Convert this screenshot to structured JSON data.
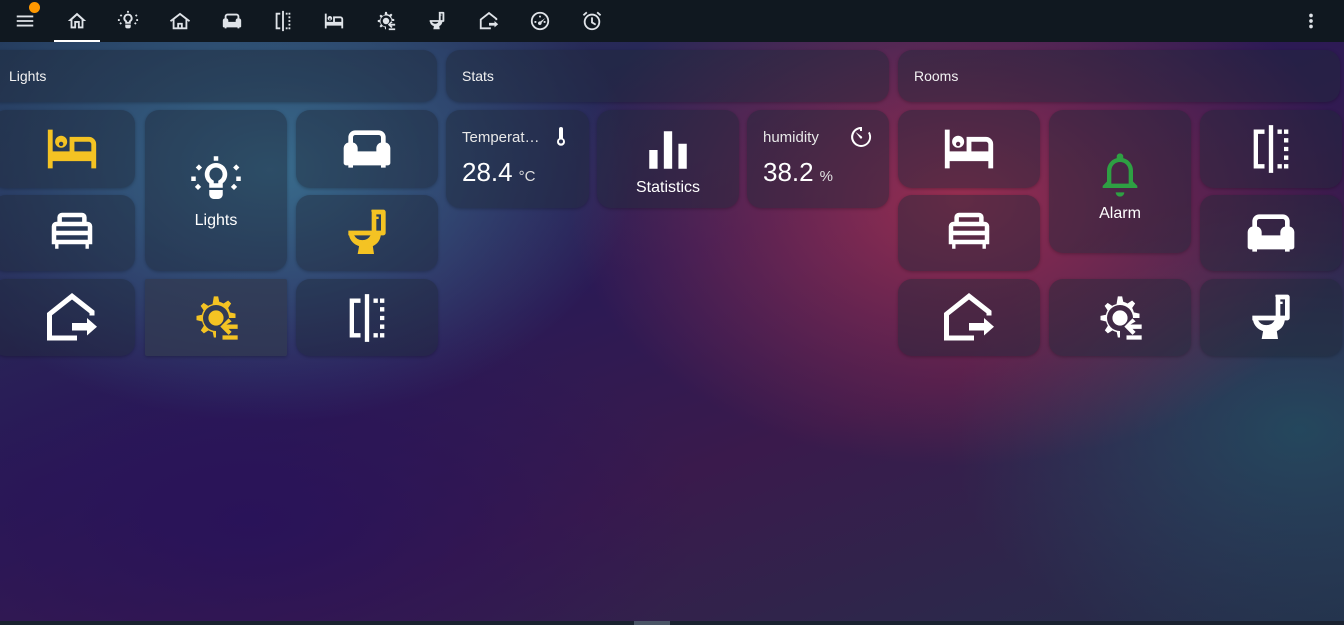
{
  "topbar": {
    "tabs": [
      {
        "icon": "menu-icon"
      },
      {
        "icon": "home-icon",
        "active": true
      },
      {
        "icon": "lightbulb-group-icon"
      },
      {
        "icon": "home-roof-icon"
      },
      {
        "icon": "sofa-icon"
      },
      {
        "icon": "door-divider-icon"
      },
      {
        "icon": "bed-icon"
      },
      {
        "icon": "cog-sync-icon"
      },
      {
        "icon": "toilet-icon"
      },
      {
        "icon": "home-export-icon"
      },
      {
        "icon": "gauge-icon"
      },
      {
        "icon": "alarm-clock-icon"
      }
    ],
    "more_icon": "dots-vertical-icon",
    "notification_color": "#ff9800"
  },
  "sections": {
    "lights": {
      "title": "Lights"
    },
    "stats": {
      "title": "Stats"
    },
    "rooms": {
      "title": "Rooms"
    }
  },
  "lights_tiles": {
    "group": {
      "name": "Lights",
      "icon": "lightbulb-group-icon"
    },
    "bedroom": {
      "icon": "bed-icon",
      "state_color": "#f4c323"
    },
    "bed": {
      "icon": "bed-double-icon"
    },
    "exit": {
      "icon": "home-export-icon"
    },
    "cog": {
      "icon": "cog-sync-icon",
      "state_color": "#f4c323"
    },
    "sofa": {
      "icon": "sofa-icon"
    },
    "toilet": {
      "icon": "toilet-icon",
      "state_color": "#f4c323"
    },
    "door": {
      "icon": "door-divider-icon"
    }
  },
  "stats": {
    "temperature": {
      "title": "Temperat…",
      "value": "28.4",
      "unit": "°C",
      "icon": "thermometer-icon"
    },
    "statistics": {
      "name": "Statistics",
      "icon": "bar-chart-icon"
    },
    "humidity": {
      "title": "humidity",
      "value": "38.2",
      "unit": "%",
      "icon": "timer-icon"
    }
  },
  "rooms_tiles": {
    "alarm": {
      "name": "Alarm",
      "icon": "bell-icon",
      "state_color": "#2ea043"
    },
    "bedroom": {
      "icon": "bed-icon"
    },
    "bed": {
      "icon": "bed-double-icon"
    },
    "exit": {
      "icon": "home-export-icon"
    },
    "cog": {
      "icon": "cog-sync-icon"
    },
    "door": {
      "icon": "door-divider-icon"
    },
    "sofa": {
      "icon": "sofa-icon"
    },
    "toilet": {
      "icon": "toilet-icon"
    }
  }
}
